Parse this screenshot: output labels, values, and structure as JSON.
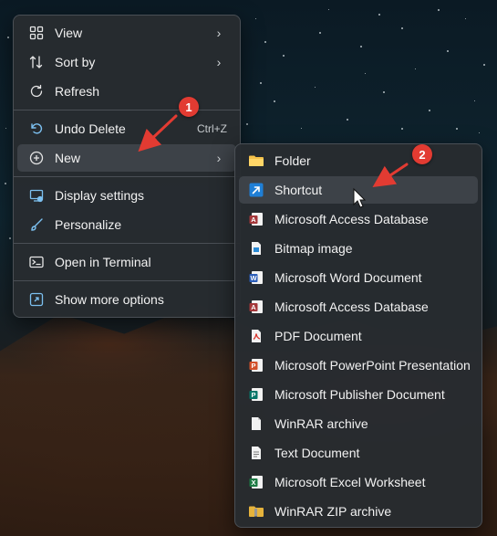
{
  "context_menu": {
    "items": [
      {
        "label": "View",
        "icon": "grid-icon"
      },
      {
        "label": "Sort by",
        "icon": "sort-icon"
      },
      {
        "label": "Refresh",
        "icon": "refresh-icon"
      },
      {
        "label": "Undo Delete",
        "icon": "undo-icon",
        "shortcut": "Ctrl+Z"
      },
      {
        "label": "New",
        "icon": "add-circle-icon"
      },
      {
        "label": "Display settings",
        "icon": "display-settings-icon"
      },
      {
        "label": "Personalize",
        "icon": "brush-icon"
      },
      {
        "label": "Open in Terminal",
        "icon": "terminal-icon"
      },
      {
        "label": "Show more options",
        "icon": "share-options-icon"
      }
    ]
  },
  "new_submenu": {
    "items": [
      {
        "label": "Folder",
        "icon": "folder-icon"
      },
      {
        "label": "Shortcut",
        "icon": "shortcut-icon"
      },
      {
        "label": "Microsoft Access Database",
        "icon": "access-icon"
      },
      {
        "label": "Bitmap image",
        "icon": "bitmap-icon"
      },
      {
        "label": "Microsoft Word Document",
        "icon": "word-icon"
      },
      {
        "label": "Microsoft Access Database",
        "icon": "access-icon"
      },
      {
        "label": "PDF Document",
        "icon": "pdf-icon"
      },
      {
        "label": "Microsoft PowerPoint Presentation",
        "icon": "powerpoint-icon"
      },
      {
        "label": "Microsoft Publisher Document",
        "icon": "publisher-icon"
      },
      {
        "label": "WinRAR archive",
        "icon": "winrar-icon"
      },
      {
        "label": "Text Document",
        "icon": "text-document-icon"
      },
      {
        "label": "Microsoft Excel Worksheet",
        "icon": "excel-icon"
      },
      {
        "label": "WinRAR ZIP archive",
        "icon": "winrar-zip-icon"
      }
    ]
  },
  "annotations": {
    "step1": "1",
    "step2": "2",
    "color": "#e23b32"
  }
}
